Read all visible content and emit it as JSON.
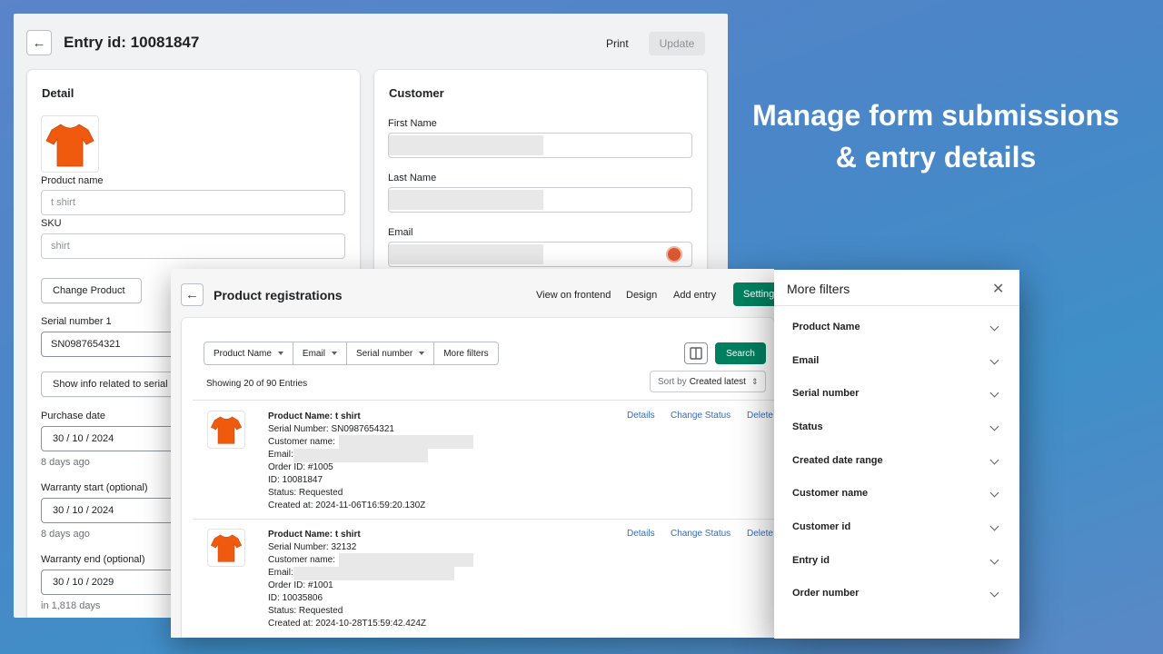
{
  "headline": {
    "line1": "Manage form submissions",
    "line2": "& entry details"
  },
  "colors": {
    "primary_green": "#008060",
    "link_blue": "#2c6ecb",
    "tshirt_orange": "#f05a0e"
  },
  "entry": {
    "back_icon": "arrow-left-icon",
    "title": "Entry id: 10081847",
    "print_label": "Print",
    "update_label": "Update",
    "detail": {
      "title": "Detail",
      "product_image": "orange-tshirt-image",
      "product_name_label": "Product name",
      "product_name_placeholder": "t shirt",
      "sku_label": "SKU",
      "sku_placeholder": "shirt",
      "change_product_label": "Change Product",
      "serial_label": "Serial number 1",
      "serial_value": "SN0987654321",
      "show_info_label": "Show info related to serial number",
      "purchase_date_label": "Purchase date",
      "purchase_date_value": "30 / 10 / 2024",
      "purchase_date_hint": "8 days ago",
      "warranty_start_label": "Warranty start (optional)",
      "warranty_start_value": "30 / 10 / 2024",
      "warranty_start_hint": "8 days ago",
      "warranty_end_label": "Warranty end (optional)",
      "warranty_end_value": "30 / 10 / 2029",
      "warranty_end_hint": "in 1,818 days"
    },
    "customer": {
      "title": "Customer",
      "first_name_label": "First Name",
      "last_name_label": "Last Name",
      "email_label": "Email",
      "email_icon": "duckduckgo-icon"
    }
  },
  "registrations": {
    "back_icon": "arrow-left-icon",
    "title": "Product registrations",
    "view_frontend_label": "View on frontend",
    "design_label": "Design",
    "add_entry_label": "Add entry",
    "settings_label": "Settings",
    "filters": [
      "Product Name",
      "Email",
      "Serial number",
      "More filters"
    ],
    "columns_icon": "columns-icon",
    "search_label": "Search",
    "showing_text": "Showing 20 of 90 Entries",
    "sort_prefix": "Sort by",
    "sort_value": "Created latest",
    "row_actions": {
      "details": "Details",
      "change_status": "Change Status",
      "delete": "Delete"
    },
    "rows": [
      {
        "product": "Product Name: t shirt",
        "serial": "Serial Number: SN0987654321",
        "customer": "Customer name:",
        "email": "Email:",
        "order": "Order ID: #1005",
        "id": "ID: 10081847",
        "status": "Status: Requested",
        "created": "Created at: 2024-11-06T16:59:20.130Z"
      },
      {
        "product": "Product Name: t shirt",
        "serial": "Serial Number: 32132",
        "customer": "Customer name:",
        "email": "Email:",
        "order": "Order ID: #1001",
        "id": "ID: 10035806",
        "status": "Status: Requested",
        "created": "Created at: 2024-10-28T15:59:42.424Z"
      }
    ]
  },
  "more_filters": {
    "title": "More filters",
    "close_icon": "close-icon",
    "items": [
      "Product Name",
      "Email",
      "Serial number",
      "Status",
      "Created date range",
      "Customer name",
      "Customer id",
      "Entry id",
      "Order number"
    ]
  }
}
